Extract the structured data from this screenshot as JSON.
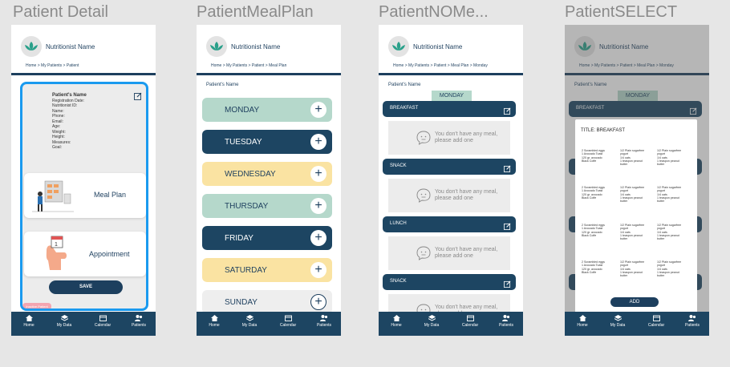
{
  "nutritionist_name": "Nutritionist Name",
  "nav": {
    "home": "Home",
    "my_data": "My Data",
    "calendar": "Calendar",
    "patients": "Patients"
  },
  "frame1": {
    "title": "Patient Detail",
    "breadcrumb": "Home > My Patients > Patient",
    "patient": {
      "name": "Patient's Name",
      "fields": [
        "Registration Date:",
        "Nutritionist ID:",
        "Name:",
        "Phone:",
        "Email:",
        "Age:",
        "Weight:",
        "Height:",
        "Measures:",
        "Goal:"
      ]
    },
    "meal_plan_label": "Meal Plan",
    "appointment_label": "Appointment",
    "save_label": "SAVE",
    "pill_label": "Inactive Patient"
  },
  "frame2": {
    "title": "PatientMealPlan",
    "breadcrumb": "Home > My Patients > Patient > Meal Plan",
    "patient_label": "Patient's Name",
    "days": [
      "MONDAY",
      "TUESDAY",
      "WEDNESDAY",
      "THURSDAY",
      "FRIDAY",
      "SATURDAY",
      "SUNDAY"
    ]
  },
  "frame3": {
    "title": "PatientNOMe...",
    "breadcrumb": "Home > My Patients > Patient > Meal Plan > Monday",
    "patient_label": "Patient's Name",
    "day_tag": "MONDAY",
    "meals": [
      "BREAKFAST",
      "SNACK",
      "LUNCH",
      "SNACK"
    ],
    "no_meal_line1": "You don't have any meal,",
    "no_meal_line2": "please add one"
  },
  "frame4": {
    "title": "PatientSELECT",
    "breadcrumb": "Home > My Patients > Patient > Meal Plan > Monday",
    "patient_label": "Patient's Name",
    "day_tag": "MONDAY",
    "meal_header": "BREAKFAST",
    "modal_title": "TITLE: BREAKFAST",
    "options": [
      [
        "2 Scrambled eggs\n1 Avocado Toast\n120 gr. avocado\nBlack Coffe",
        "1/2 Plain sugarfree\nyogurt\n1/4 oats\n1 teaspon peanut\nbutter",
        "1/2 Plain sugarfree\nyogurt\n1/4 oats\n1 teaspon peanut\nbutter"
      ],
      [
        "2 Scrambled eggs\n1 Avocado Toast\n120 gr. avocado\nBlack Coffe",
        "1/2 Plain sugarfree\nyogurt\n1/4 oats\n1 teaspon peanut\nbutter",
        "1/2 Plain sugarfree\nyogurt\n1/4 oats\n1 teaspon peanut\nbutter"
      ],
      [
        "2 Scrambled eggs\n1 Avocado Toast\n120 gr. avocado\nBlack Coffe",
        "1/2 Plain sugarfree\nyogurt\n1/4 oats\n1 teaspon peanut\nbutter",
        "1/2 Plain sugarfree\nyogurt\n1/4 oats\n1 teaspon peanut\nbutter"
      ],
      [
        "2 Scrambled eggs\n1 Avocado Toast\n120 gr. avocado\nBlack Coffe",
        "1/2 Plain sugarfree\nyogurt\n1/4 oats\n1 teaspon peanut\nbutter",
        "1/2 Plain sugarfree\nyogurt\n1/4 oats\n1 teaspon peanut\nbutter"
      ]
    ],
    "add_label": "ADD"
  },
  "colors": {
    "navy": "#1d3f5e",
    "nav_bar": "#1d4562",
    "mint": "#b5d8cb",
    "yellow": "#fae3a2",
    "selection_blue": "#1a9aef",
    "logo_teal": "#2aa08a"
  }
}
